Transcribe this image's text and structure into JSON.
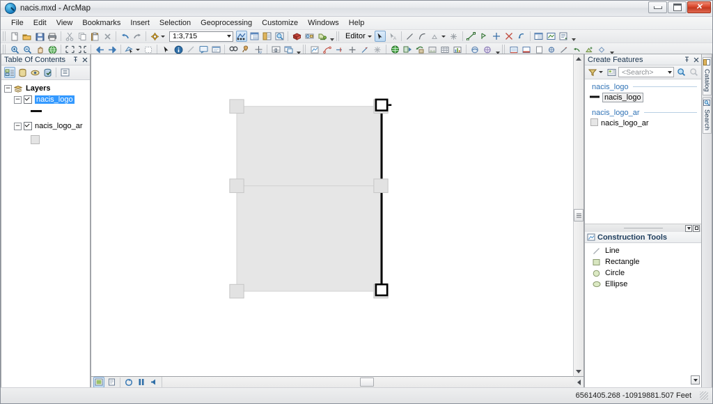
{
  "window": {
    "title": "nacis.mxd - ArcMap",
    "app_icon": "arcmap-globe-icon",
    "controls": {
      "minimize": "–",
      "maximize": "□",
      "close": "✕"
    }
  },
  "menubar": {
    "items": [
      "File",
      "Edit",
      "View",
      "Bookmarks",
      "Insert",
      "Selection",
      "Geoprocessing",
      "Customize",
      "Windows",
      "Help"
    ]
  },
  "standard_toolbar": {
    "buttons": [
      "new-document",
      "open-document",
      "save-document",
      "print",
      "cut",
      "copy",
      "paste",
      "delete",
      "undo",
      "redo",
      "add-data"
    ],
    "scale": {
      "value": "1:3,715",
      "label": "map-scale-combo"
    },
    "right_buttons": [
      "editor-toolbar-toggle",
      "table-of-contents",
      "catalog-window",
      "search-window",
      "arctoolbox",
      "model-builder",
      "python-window",
      "scripting"
    ]
  },
  "tools_toolbar": {
    "buttons": [
      "zoom-in",
      "zoom-out",
      "pan",
      "full-extent",
      "fixed-zoom-in",
      "fixed-zoom-out",
      "previous-extent",
      "next-extent",
      "select-features",
      "clear-selection",
      "select-elements",
      "identify",
      "measure",
      "hyperlink",
      "html-popup",
      "find",
      "find-route",
      "go-to-xy",
      "time-slider",
      "create-viewer-window"
    ]
  },
  "editor_toolbar": {
    "label": "Editor",
    "buttons": [
      "edit-tool",
      "edit-annotation",
      "straight-segment",
      "end-point-arc",
      "trace",
      "point",
      "split",
      "rotate",
      "edit-vertices",
      "reshape",
      "cut-polygons",
      "mirror",
      "attributes",
      "sketch-properties",
      "create-features-window",
      "attribute-table"
    ]
  },
  "toc": {
    "title": "Table Of Contents",
    "pin_icon": "pin-icon",
    "close_icon": "close-icon",
    "tools": [
      "list-by-drawing-order",
      "list-by-source",
      "list-by-visibility",
      "list-by-selection",
      "options"
    ],
    "root": "Layers",
    "layers": [
      {
        "name": "nacis_logo",
        "checked": true,
        "selected": true,
        "symbol": "line"
      },
      {
        "name": "nacis_logo_ar",
        "checked": true,
        "selected": false,
        "symbol": "polygon"
      }
    ]
  },
  "create_features": {
    "title": "Create Features",
    "pin_icon": "pin-icon",
    "close_icon": "close-icon",
    "search": {
      "placeholder": "<Search>",
      "filter_icon": "filter-icon",
      "organize_icon": "organize-templates-icon",
      "search_icon": "search-icon"
    },
    "groups": [
      {
        "header": "nacis_logo",
        "templates": [
          {
            "label": "nacis_logo",
            "symbol": "line",
            "selected": true
          }
        ]
      },
      {
        "header": "nacis_logo_ar",
        "templates": [
          {
            "label": "nacis_logo_ar",
            "symbol": "polygon",
            "selected": false
          }
        ]
      }
    ]
  },
  "construction_tools": {
    "title": "Construction Tools",
    "icon": "construction-tools-icon",
    "tools": [
      {
        "label": "Line",
        "icon": "line-icon"
      },
      {
        "label": "Rectangle",
        "icon": "rectangle-icon"
      },
      {
        "label": "Circle",
        "icon": "circle-icon"
      },
      {
        "label": "Ellipse",
        "icon": "ellipse-icon"
      }
    ],
    "scroll_icon": "scroll-down-icon"
  },
  "side_tabs": [
    {
      "label": "Catalog",
      "icon": "catalog-icon"
    },
    {
      "label": "Search",
      "icon": "search-icon"
    }
  ],
  "map_view": {
    "view_buttons": [
      "data-view",
      "layout-view"
    ],
    "nav_buttons": [
      "refresh",
      "pause-drawing",
      "toggle-drawing"
    ],
    "features": {
      "polygon": {
        "fill": "#e6e6e6",
        "stroke": "#d0d0d0"
      },
      "line": {
        "stroke": "#000000",
        "width": 3
      },
      "selection_handle": {
        "fill": "#e0e0e0",
        "stroke": "#c2c2c2"
      },
      "vertex_handle": {
        "fill": "#ffffff",
        "stroke": "#000000"
      }
    },
    "cursor": "arrow-cursor"
  },
  "statusbar": {
    "coordinates": "6561405.268  -10919881.507 Feet",
    "resize_grip": "resize-grip-icon"
  },
  "colors": {
    "selection_blue": "#3399ff",
    "group_header_blue": "#2f72b5",
    "panel_title": "#19334d",
    "close_red": "#d8452a"
  }
}
